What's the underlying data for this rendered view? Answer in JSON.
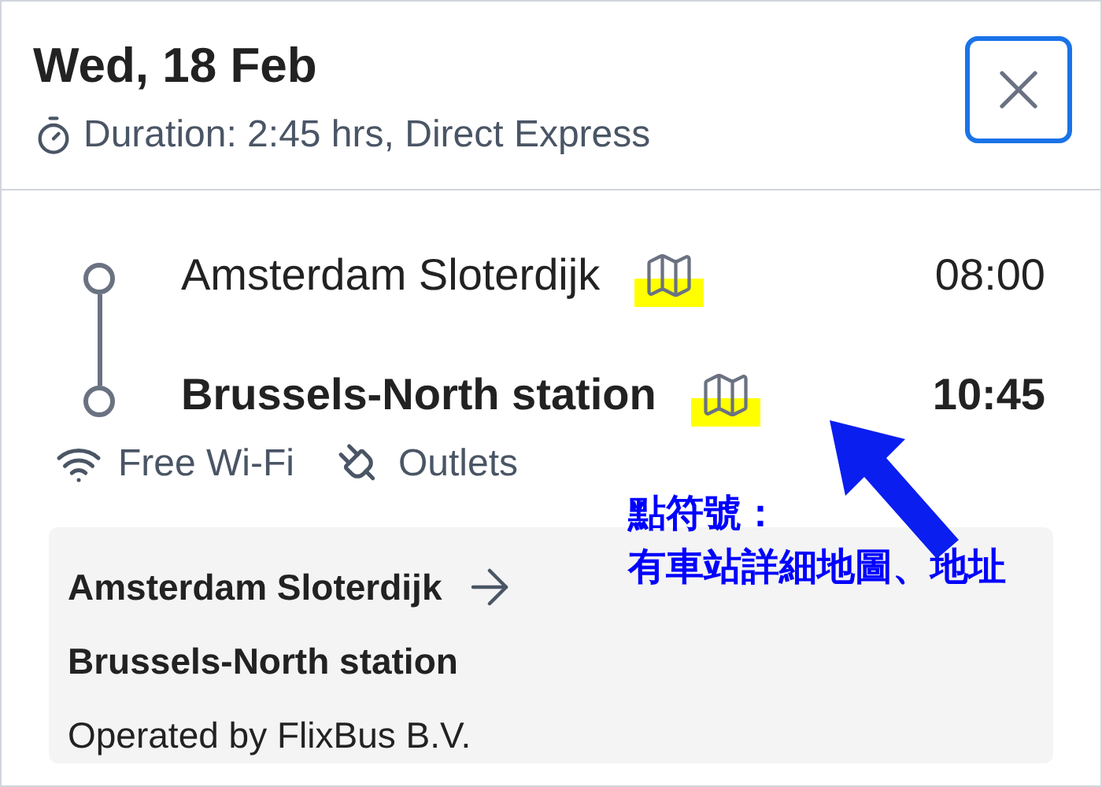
{
  "header": {
    "date": "Wed, 18 Feb",
    "duration": "Duration: 2:45 hrs, Direct Express"
  },
  "stops": [
    {
      "name": "Amsterdam Sloterdijk",
      "time": "08:00",
      "bold": false,
      "highlighted": true
    },
    {
      "name": "Brussels-North station",
      "time": "10:45",
      "bold": true,
      "highlighted": true
    }
  ],
  "amenities": [
    {
      "kind": "wifi",
      "label": "Free Wi-Fi"
    },
    {
      "kind": "outlet",
      "label": "Outlets"
    }
  ],
  "summary": {
    "from": "Amsterdam Sloterdijk",
    "to": "Brussels-North station",
    "operator": "Operated by FlixBus B.V."
  },
  "annotation": {
    "lines": [
      "點符號：",
      "有車站詳細地圖、地址"
    ]
  }
}
